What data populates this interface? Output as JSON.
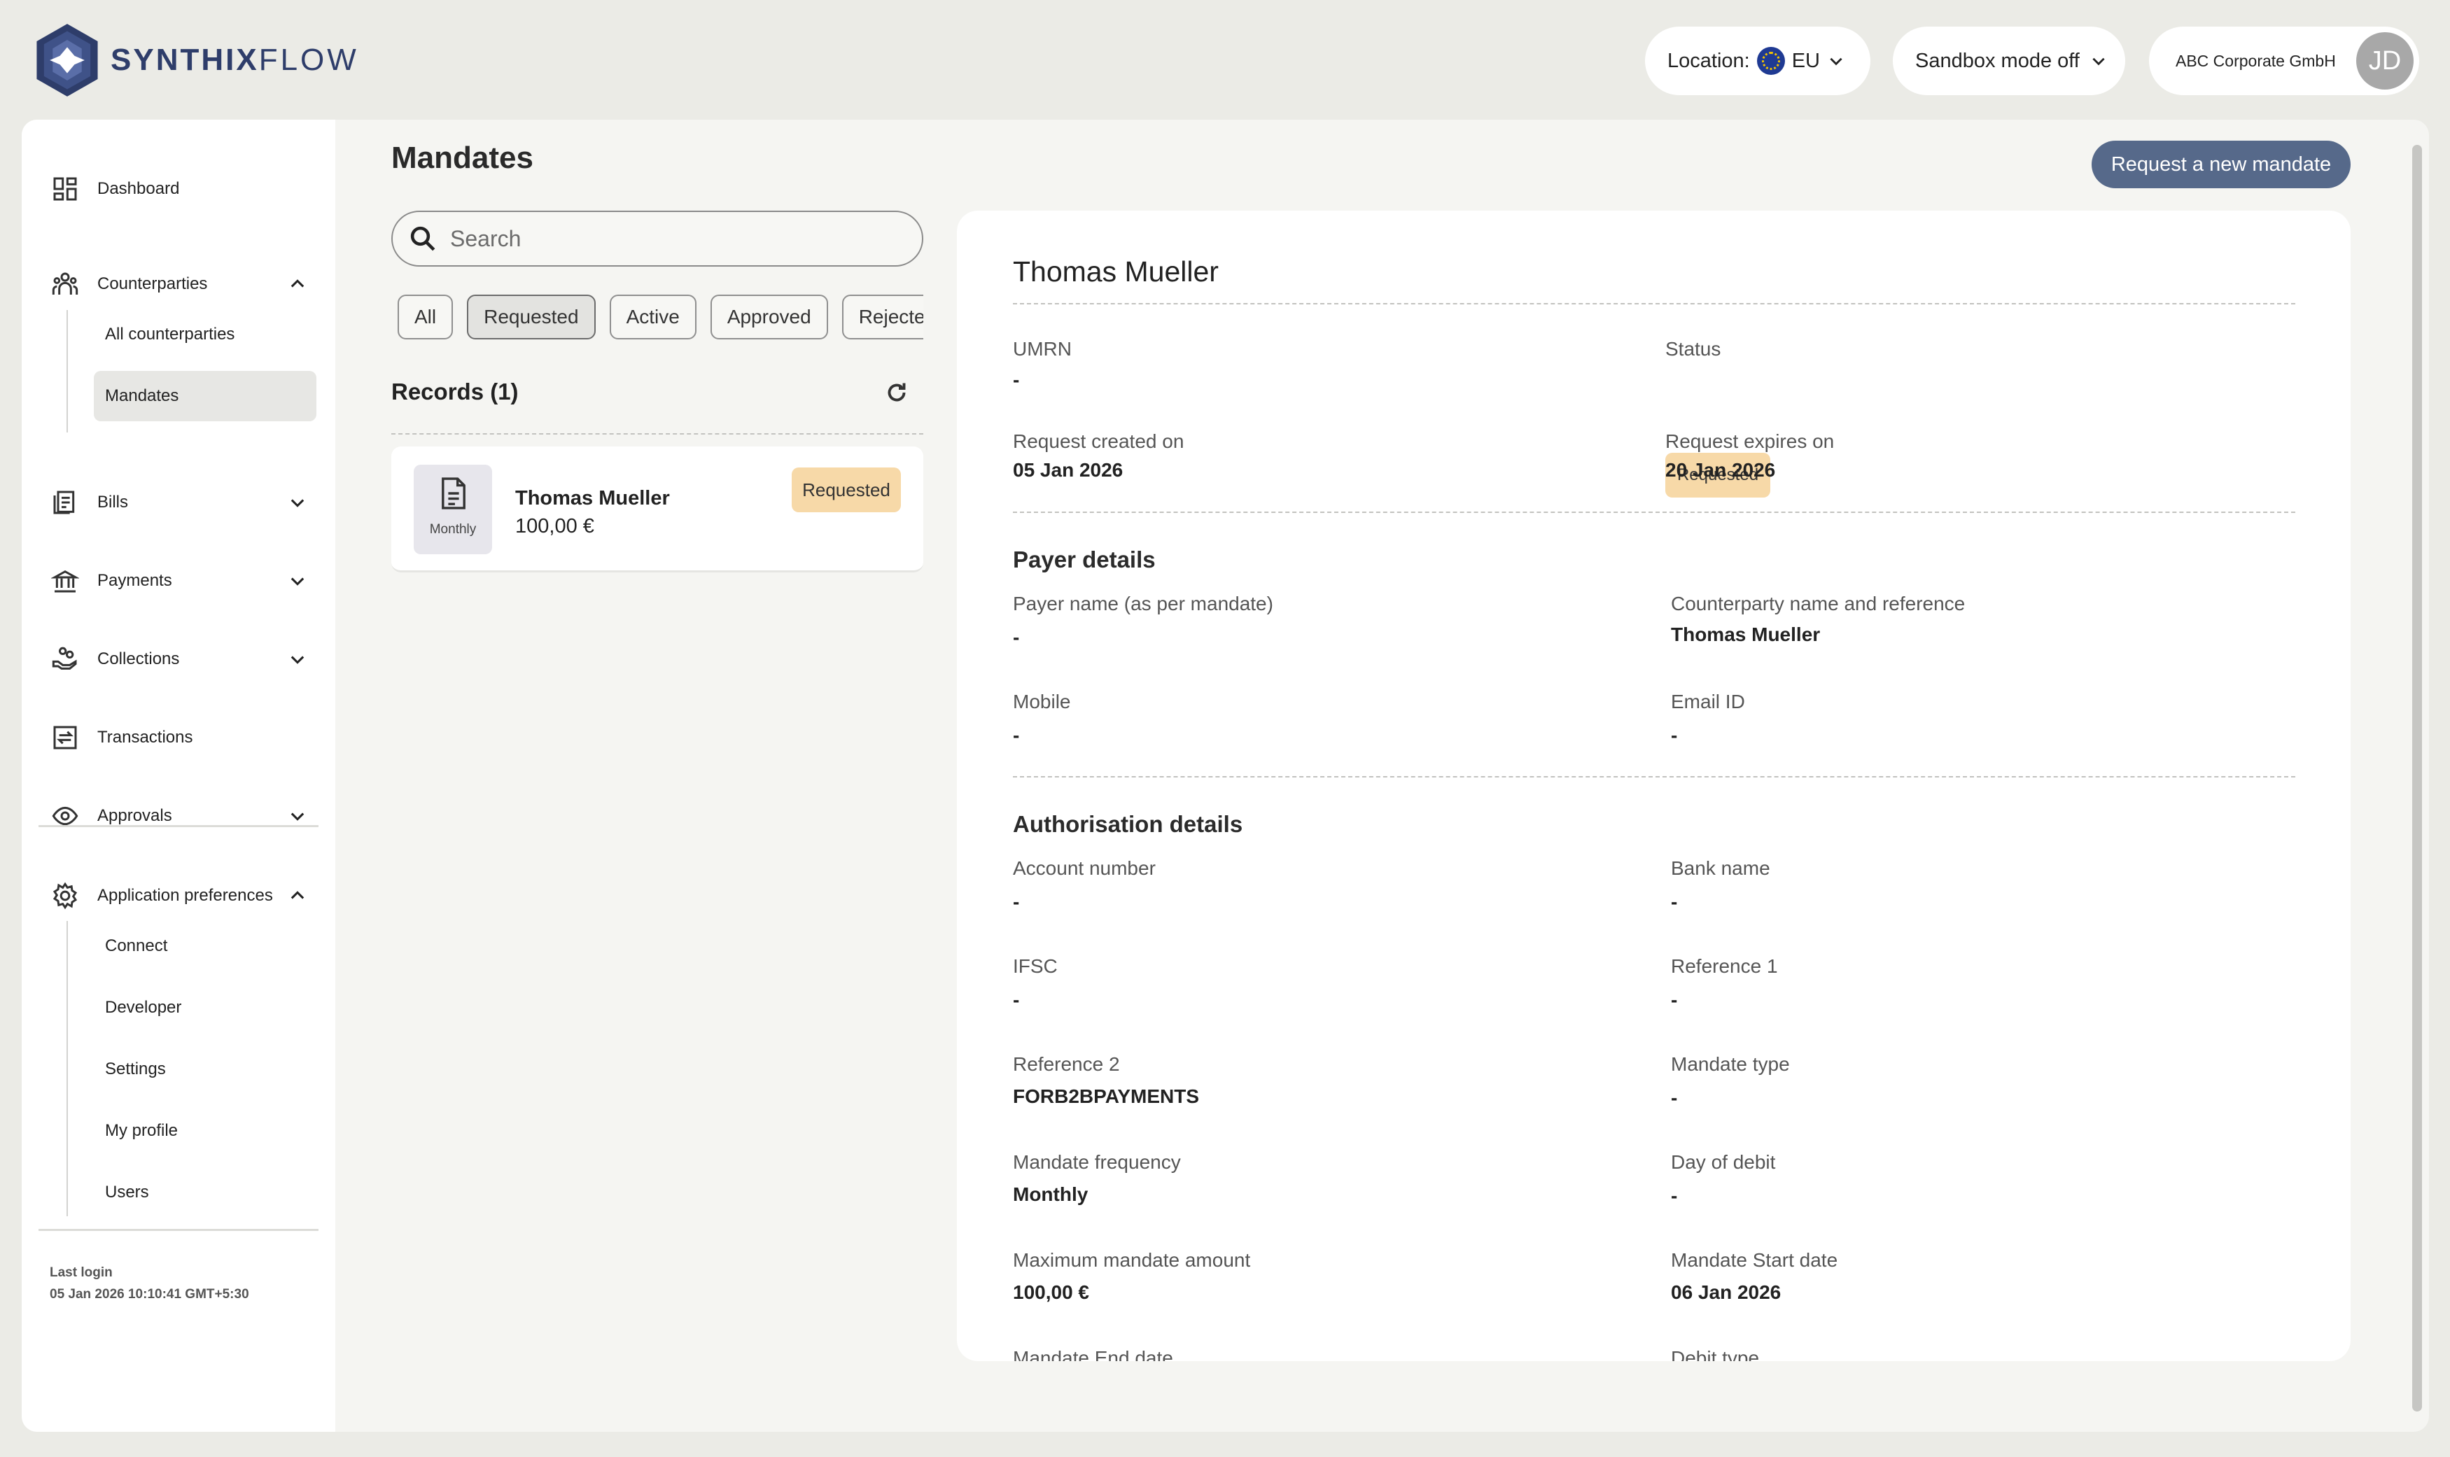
{
  "brand": {
    "name_bold": "SYNTHIX",
    "name_light": "FLOW"
  },
  "header": {
    "location_label": "Location:",
    "location_value": "EU",
    "sandbox_label": "Sandbox mode off",
    "account_name": "ABC Corporate GmbH",
    "avatar_initials": "JD"
  },
  "sidebar": {
    "dashboard": "Dashboard",
    "counterparties": "Counterparties",
    "counterparties_children": [
      "All counterparties",
      "Mandates"
    ],
    "bills": "Bills",
    "payments": "Payments",
    "collections": "Collections",
    "transactions": "Transactions",
    "approvals": "Approvals",
    "app_prefs": "Application preferences",
    "app_prefs_children": [
      "Connect",
      "Developer",
      "Settings",
      "My profile",
      "Users"
    ],
    "last_login_label": "Last login",
    "last_login_value": "05 Jan 2026 10:10:41 GMT+5:30"
  },
  "page": {
    "title": "Mandates",
    "new_button": "Request a new mandate",
    "search_placeholder": "Search",
    "filters": [
      "All",
      "Requested",
      "Active",
      "Approved",
      "Rejected"
    ],
    "records_title": "Records (1)"
  },
  "record": {
    "name": "Thomas Mueller",
    "amount": "100,00 €",
    "frequency": "Monthly",
    "status": "Requested"
  },
  "detail": {
    "name": "Thomas Mueller",
    "umrn_label": "UMRN",
    "umrn_value": "-",
    "status_label": "Status",
    "status_value": "Requested",
    "created_label": "Request created on",
    "created_value": "05 Jan 2026",
    "expires_label": "Request expires on",
    "expires_value": "20 Jan 2026",
    "payer_section": "Payer details",
    "payer_name_label": "Payer name (as per mandate)",
    "payer_name_value": "-",
    "cp_label": "Counterparty name and reference",
    "cp_value": "Thomas Mueller",
    "mobile_label": "Mobile",
    "mobile_value": "-",
    "email_label": "Email ID",
    "email_value": "-",
    "auth_section": "Authorisation details",
    "account_label": "Account number",
    "account_value": "-",
    "bank_label": "Bank name",
    "bank_value": "-",
    "ifsc_label": "IFSC",
    "ifsc_value": "-",
    "ref1_label": "Reference 1",
    "ref1_value": "-",
    "ref2_label": "Reference 2",
    "ref2_value": "FORB2BPAYMENTS",
    "type_label": "Mandate type",
    "type_value": "-",
    "freq_label": "Mandate frequency",
    "freq_value": "Monthly",
    "debit_day_label": "Day of debit",
    "debit_day_value": "-",
    "max_label": "Maximum mandate amount",
    "max_value": "100,00 €",
    "start_label": "Mandate Start date",
    "start_value": "06 Jan 2026",
    "end_label": "Mandate End date",
    "debit_type_label": "Debit type"
  },
  "colors": {
    "brand": "#2e3d6a",
    "primary_button": "#56698a",
    "requested_badge": "#f7d9a8"
  }
}
